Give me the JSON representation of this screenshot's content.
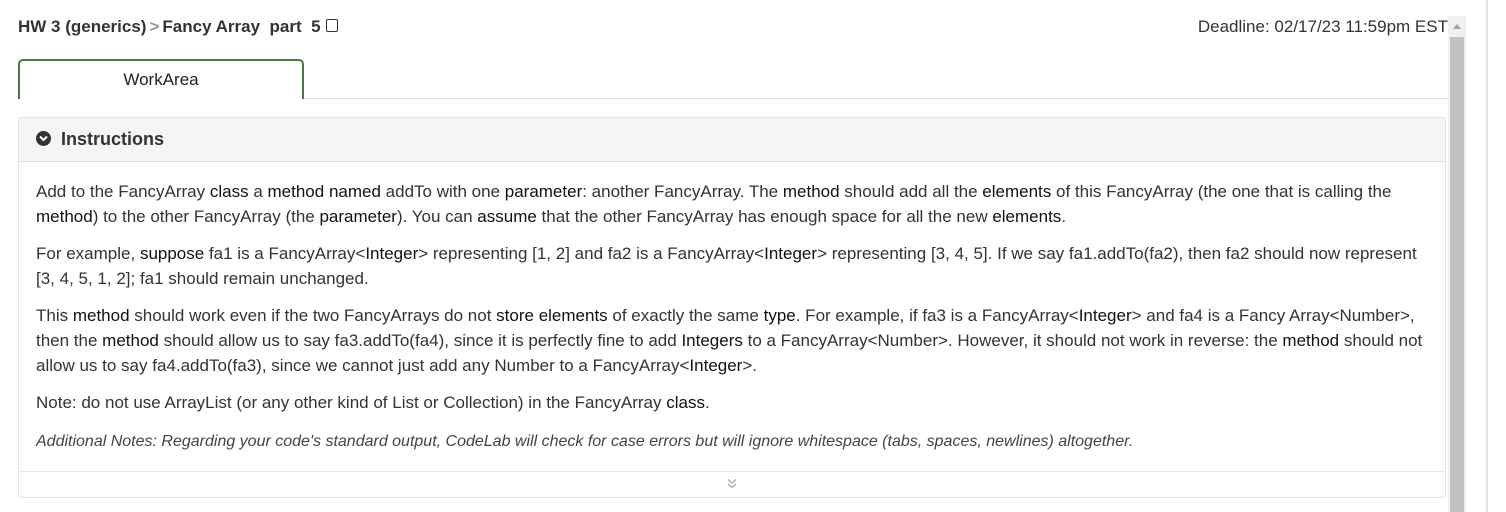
{
  "header": {
    "breadcrumb_parent": "HW 3 (generics)",
    "breadcrumb_separator": ">",
    "breadcrumb_current": "Fancy Array  part  5",
    "deadline": "Deadline: 02/17/23 11:59pm EST"
  },
  "tabs": [
    {
      "label": "WorkArea",
      "active": true
    }
  ],
  "instructions": {
    "title": "Instructions",
    "paragraphs": [
      [
        {
          "t": "Add to the FancyArray "
        },
        {
          "t": "class",
          "kw": true
        },
        {
          "t": " a "
        },
        {
          "t": "method",
          "kw": true
        },
        {
          "t": " "
        },
        {
          "t": "named",
          "kw": true
        },
        {
          "t": " addTo with one "
        },
        {
          "t": "parameter",
          "kw": true
        },
        {
          "t": ": another FancyArray. The "
        },
        {
          "t": "method",
          "kw": true
        },
        {
          "t": " should add all the "
        },
        {
          "t": "elements",
          "kw": true
        },
        {
          "t": " of this FancyArray (the one that is calling the "
        },
        {
          "t": "method",
          "kw": true
        },
        {
          "t": ") to the other FancyArray (the "
        },
        {
          "t": "parameter",
          "kw": true
        },
        {
          "t": "). You can "
        },
        {
          "t": "assume",
          "kw": true
        },
        {
          "t": " that the other FancyArray has enough space for all the new "
        },
        {
          "t": "elements",
          "kw": true
        },
        {
          "t": "."
        }
      ],
      [
        {
          "t": "For example, "
        },
        {
          "t": "suppose",
          "kw": true
        },
        {
          "t": " fa1 is a FancyArray<"
        },
        {
          "t": "Integer",
          "kw": true
        },
        {
          "t": "> representing [1, 2] and fa2 is a FancyArray<"
        },
        {
          "t": "Integer",
          "kw": true
        },
        {
          "t": "> representing [3, 4, 5]. If we say fa1.addTo(fa2), then fa2 should now represent [3, 4, 5, 1, 2]; fa1 should remain unchanged."
        }
      ],
      [
        {
          "t": "This "
        },
        {
          "t": "method",
          "kw": true
        },
        {
          "t": " should work even if the two FancyArrays do not "
        },
        {
          "t": "store",
          "kw": true
        },
        {
          "t": " "
        },
        {
          "t": "elements",
          "kw": true
        },
        {
          "t": " of exactly the same "
        },
        {
          "t": "type",
          "kw": true
        },
        {
          "t": ". For example, if fa3 is a FancyArray<"
        },
        {
          "t": "Integer",
          "kw": true
        },
        {
          "t": "> and fa4 is a Fancy Array<Number>, then the "
        },
        {
          "t": "method",
          "kw": true
        },
        {
          "t": " should allow us to say fa3.addTo(fa4), since it is perfectly fine to add "
        },
        {
          "t": "Integers",
          "kw": true
        },
        {
          "t": " to a FancyArray<Number>. However, it should not work in reverse: the "
        },
        {
          "t": "method",
          "kw": true
        },
        {
          "t": " should not allow us to say fa4.addTo(fa3), since we cannot just add any Number to a FancyArray<"
        },
        {
          "t": "Integer",
          "kw": true
        },
        {
          "t": ">."
        }
      ],
      [
        {
          "t": "Note: do not use ArrayList (or any other kind of List or Collection) in the FancyArray "
        },
        {
          "t": "class",
          "kw": true
        },
        {
          "t": "."
        }
      ]
    ],
    "additional_notes": "Additional Notes: Regarding your code's standard output, CodeLab will check for case errors but will ignore whitespace (tabs, spaces, newlines) altogether."
  },
  "icons": {
    "checkbox": "checkbox-icon",
    "collapse": "chevron-circle-down-icon",
    "expand": "double-chevron-down-icon"
  }
}
